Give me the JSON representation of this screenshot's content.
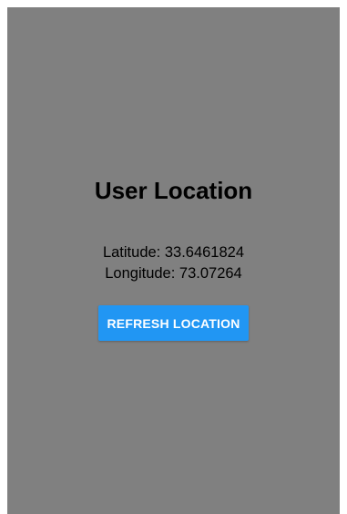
{
  "screen": {
    "title": "User Location",
    "latitude_label": "Latitude:",
    "latitude_value": "33.6461824",
    "longitude_label": "Longitude:",
    "longitude_value": "73.07264",
    "refresh_label": "REFRESH LOCATION"
  },
  "colors": {
    "background": "#808080",
    "button": "#2196f3",
    "button_text": "#ffffff",
    "text": "#000000"
  }
}
